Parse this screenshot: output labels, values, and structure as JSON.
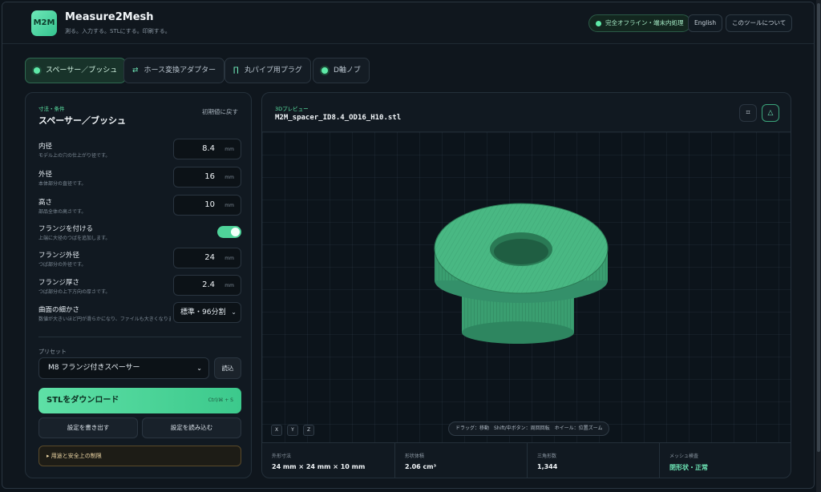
{
  "header": {
    "logo_text": "M2M",
    "title": "Measure2Mesh",
    "subtitle": "測る。入力する。STLにする。印刷する。",
    "offline_badge": "完全オフライン・端末内処理",
    "lang_button": "English",
    "about_button": "このツールについて"
  },
  "tabs": [
    {
      "label": "スペーサー／ブッシュ",
      "icon": "dot-icon",
      "active": true
    },
    {
      "label": "ホース変換アダプター",
      "icon": "swap-arrows-icon",
      "active": false
    },
    {
      "label": "丸パイプ用プラグ",
      "icon": "plug-icon",
      "active": false
    },
    {
      "label": "D軸ノブ",
      "icon": "dot-icon",
      "active": false
    }
  ],
  "form": {
    "section_label": "寸法・条件",
    "title": "スペーサー／ブッシュ",
    "reset": "初期値に戻す",
    "fields": [
      {
        "label": "内径",
        "hint": "モデル上の穴の仕上がり径です。",
        "value": "8.4",
        "unit": "mm"
      },
      {
        "label": "外径",
        "hint": "本体部分の直径です。",
        "value": "16",
        "unit": "mm"
      },
      {
        "label": "高さ",
        "hint": "部品全体の高さです。",
        "value": "10",
        "unit": "mm"
      },
      {
        "label": "フランジを付ける",
        "hint": "上端に大径のつばを追加します。",
        "toggle": true
      },
      {
        "label": "フランジ外径",
        "hint": "つば部分の外径です。",
        "value": "24",
        "unit": "mm"
      },
      {
        "label": "フランジ厚さ",
        "hint": "つば部分の上下方向の厚さです。",
        "value": "2.4",
        "unit": "mm"
      },
      {
        "label": "曲面の細かさ",
        "hint": "数値が大きいほど円が滑らかになり、ファイルも大きくなります。",
        "select": "標準・96分割"
      }
    ],
    "preset_label": "プリセット",
    "preset_value": "M8 フランジ付きスペーサー",
    "load_button": "読込",
    "download_button": "STLをダウンロード",
    "download_shortcut": "Ctrl/⌘ + S",
    "export_button": "設定を書き出す",
    "import_button": "設定を読み込む",
    "safety_notice": "▸ 用途と安全上の制限"
  },
  "preview": {
    "label": "3Dプレビュー",
    "filename": "M2M_spacer_ID8.4_OD16_H10.stl",
    "axis_buttons": [
      "X",
      "Y",
      "Z"
    ],
    "hint": "ドラッグ：移動　Shift/中ボタン：周回回転　ホイール：位置ズーム",
    "model_color": "#3fa877",
    "stats": [
      {
        "key": "外形寸法",
        "value": "24 mm × 24 mm × 10 mm"
      },
      {
        "key": "形状体積",
        "value": "2.06 cm³"
      },
      {
        "key": "三角形数",
        "value": "1,344"
      },
      {
        "key": "メッシュ検査",
        "value": "閉形状・正常",
        "good": true
      }
    ]
  }
}
